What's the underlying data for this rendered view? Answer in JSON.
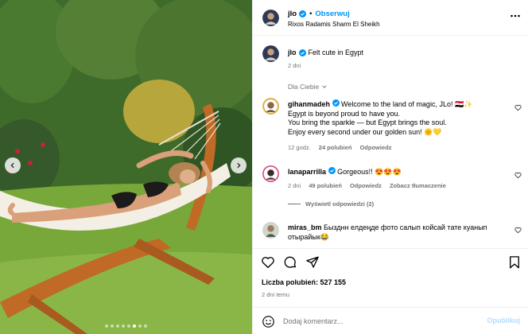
{
  "post": {
    "username": "jlo",
    "follow_label": "Obserwuj",
    "separator": "•",
    "location": "Rixos Radamis Sharm El Sheikh",
    "caption_user": "jlo",
    "caption": "Felt cute in Egypt",
    "caption_time": "2 dni",
    "carousel": {
      "slide_count": 8,
      "active_index": 5
    }
  },
  "comments_filter": "Dla Ciebie",
  "comments": [
    {
      "user": "gihanmadeh",
      "verified": true,
      "lines": [
        "Welcome to the land of magic, JLo! 🇪🇬✨",
        "Egypt is beyond proud to have you.",
        "You bring the sparkle — but Egypt brings the soul.",
        "Enjoy every second under our golden sun! 🌞💛"
      ],
      "time": "12 godz.",
      "likes": "24 polubień",
      "reply": "Odpowiedz",
      "translate": ""
    },
    {
      "user": "lanaparrilla",
      "verified": true,
      "lines": [
        "Gorgeous!! 😍😍😍"
      ],
      "time": "2 dni",
      "likes": "49 polubień",
      "reply": "Odpowiedz",
      "translate": "Zobacz tłumaczenie"
    },
    {
      "user": "miras_bm",
      "verified": false,
      "lines": [
        "Бызднн елдеңде фото салып койсай тате куанып",
        "отырайык😂"
      ],
      "time": "",
      "likes": "",
      "reply": "",
      "translate": ""
    }
  ],
  "replies_label": "Wyświetl odpowiedzi (2)",
  "likes_label": "Liczba polubień: 527 155",
  "posted_ago": "2 dni temu",
  "add_comment": {
    "placeholder": "Dodaj komentarz...",
    "publish_label": "Opublikuj"
  },
  "icons": [
    "more-icon",
    "verified-icon",
    "heart-icon",
    "comment-icon",
    "share-icon",
    "bookmark-icon",
    "emoji-icon",
    "chevron-down-icon",
    "chevron-left-icon",
    "chevron-right-icon"
  ],
  "colors": {
    "accent": "#0095f6",
    "muted": "#737373",
    "publish_disabled": "#b3dbff",
    "divider": "#efefef"
  }
}
